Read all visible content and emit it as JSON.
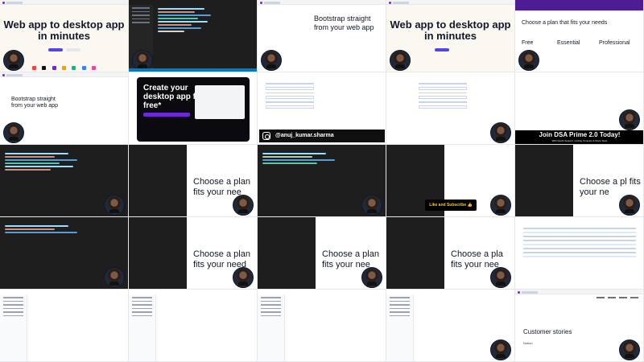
{
  "tiles": {
    "r1c1": {
      "title": "Web app to desktop app in minutes"
    },
    "r1c3": {
      "title": "Bootstrap straight from your web app"
    },
    "r1c4": {
      "title": "Web app to desktop app in minutes"
    },
    "r1c5": {
      "title": "Choose a plan that fits your needs",
      "plans": [
        "Free",
        "Essential",
        "Professional"
      ]
    },
    "r2c1": {
      "title": "Bootstrap straight from your web app"
    },
    "r2c2": {
      "title": "Create your desktop app for free*"
    },
    "r2c3": {
      "handle": "@anuj_kumar.sharma"
    },
    "r2c5": {
      "banner_title": "Join DSA Prime 2.0 Today!",
      "banner_sub": "With Doubt Support, Coding Contests & Mock Tests"
    },
    "r3c4": {
      "like_label": "Like and Subscribe 👍"
    },
    "r3c2": {
      "title": "Choose a plan fits your nee"
    },
    "r3c5": {
      "title": "Choose a pl fits your ne"
    },
    "r4c2": {
      "title": "Choose a plan fits your need"
    },
    "r4c3": {
      "title": "Choose a plan fits your nee"
    },
    "r4c4": {
      "title": "Choose a pla fits your nee"
    },
    "r5c5": {
      "title": "Customer stories",
      "sub": "Notion"
    }
  },
  "colors": {
    "editor_bg": "#1e1e1e",
    "accent": "#4f46e5",
    "brand_purple": "#6d28d9",
    "status_blue": "#007acc"
  }
}
